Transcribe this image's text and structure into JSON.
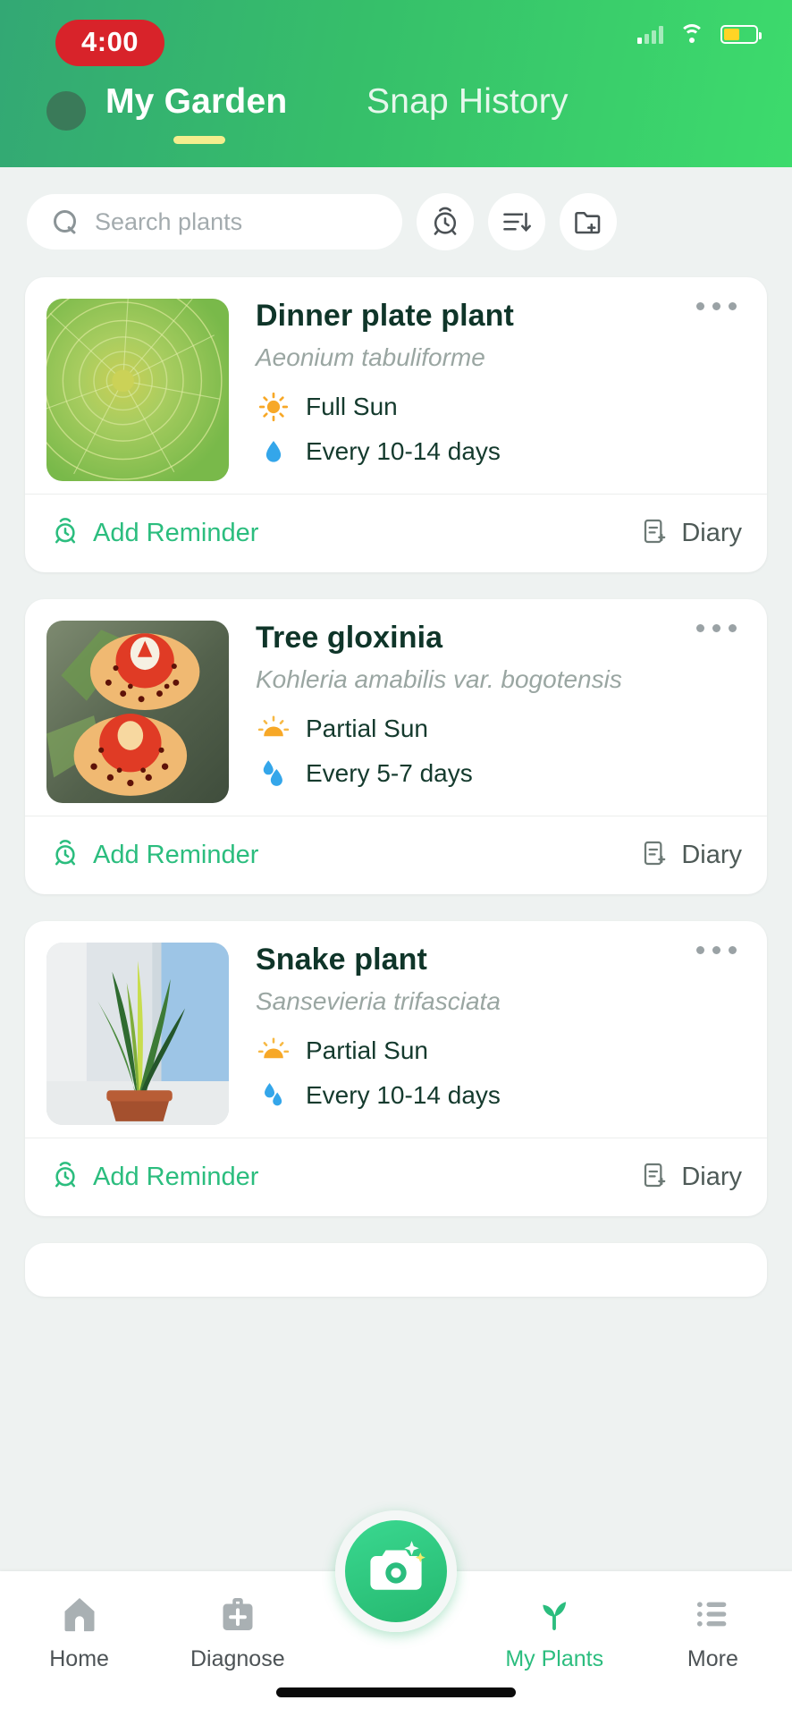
{
  "status_bar": {
    "time": "4:00",
    "signal_icon": "cellular-signal-icon",
    "wifi_icon": "wifi-icon",
    "battery_icon": "battery-icon"
  },
  "header": {
    "avatar_icon": "avatar",
    "tabs": [
      {
        "label": "My Garden",
        "active": true
      },
      {
        "label": "Snap History",
        "active": false
      }
    ],
    "accent_color": "#3ddb6c",
    "underline_color": "#f4ee8e"
  },
  "search": {
    "placeholder": "Search plants",
    "value": "",
    "icon": "search-icon",
    "actions": [
      {
        "name": "reminders-button",
        "icon": "alarm-clock-icon"
      },
      {
        "name": "sort-button",
        "icon": "sort-descending-icon"
      },
      {
        "name": "new-folder-button",
        "icon": "folder-plus-icon"
      }
    ]
  },
  "plants": [
    {
      "name": "Dinner plate plant",
      "latin": "Aeonium tabuliforme",
      "light": "Full Sun",
      "light_icon": "full-sun-icon",
      "water": "Every 10-14 days",
      "water_icon": "water-drop-single-icon",
      "menu_icon": "more-options-icon",
      "reminder_label": "Add Reminder",
      "reminder_icon": "alarm-clock-icon",
      "diary_label": "Diary",
      "diary_icon": "note-plus-icon",
      "thumb": "succulent-rosette-photo"
    },
    {
      "name": "Tree gloxinia",
      "latin": "Kohleria amabilis var. bogotensis",
      "light": "Partial Sun",
      "light_icon": "partial-sun-icon",
      "water": "Every 5-7 days",
      "water_icon": "water-drop-double-icon",
      "menu_icon": "more-options-icon",
      "reminder_label": "Add Reminder",
      "reminder_icon": "alarm-clock-icon",
      "diary_label": "Diary",
      "diary_icon": "note-plus-icon",
      "thumb": "red-spotted-flower-photo"
    },
    {
      "name": "Snake plant",
      "latin": "Sansevieria trifasciata",
      "light": "Partial Sun",
      "light_icon": "partial-sun-icon",
      "water": "Every 10-14 days",
      "water_icon": "water-drop-double-icon",
      "menu_icon": "more-options-icon",
      "reminder_label": "Add Reminder",
      "reminder_icon": "alarm-clock-icon",
      "diary_label": "Diary",
      "diary_icon": "note-plus-icon",
      "thumb": "snake-plant-windowsill-photo"
    }
  ],
  "bottom_nav": {
    "items": [
      {
        "label": "Home",
        "icon": "home-icon",
        "active": false
      },
      {
        "label": "Diagnose",
        "icon": "medical-bag-icon",
        "active": false
      },
      {
        "label": "My Plants",
        "icon": "sprout-icon",
        "active": true
      },
      {
        "label": "More",
        "icon": "list-icon",
        "active": false
      }
    ],
    "fab": {
      "name": "camera-capture-button",
      "icon": "camera-sparkle-icon"
    },
    "active_color": "#2bbd7e",
    "inactive_color": "#4d5356"
  }
}
